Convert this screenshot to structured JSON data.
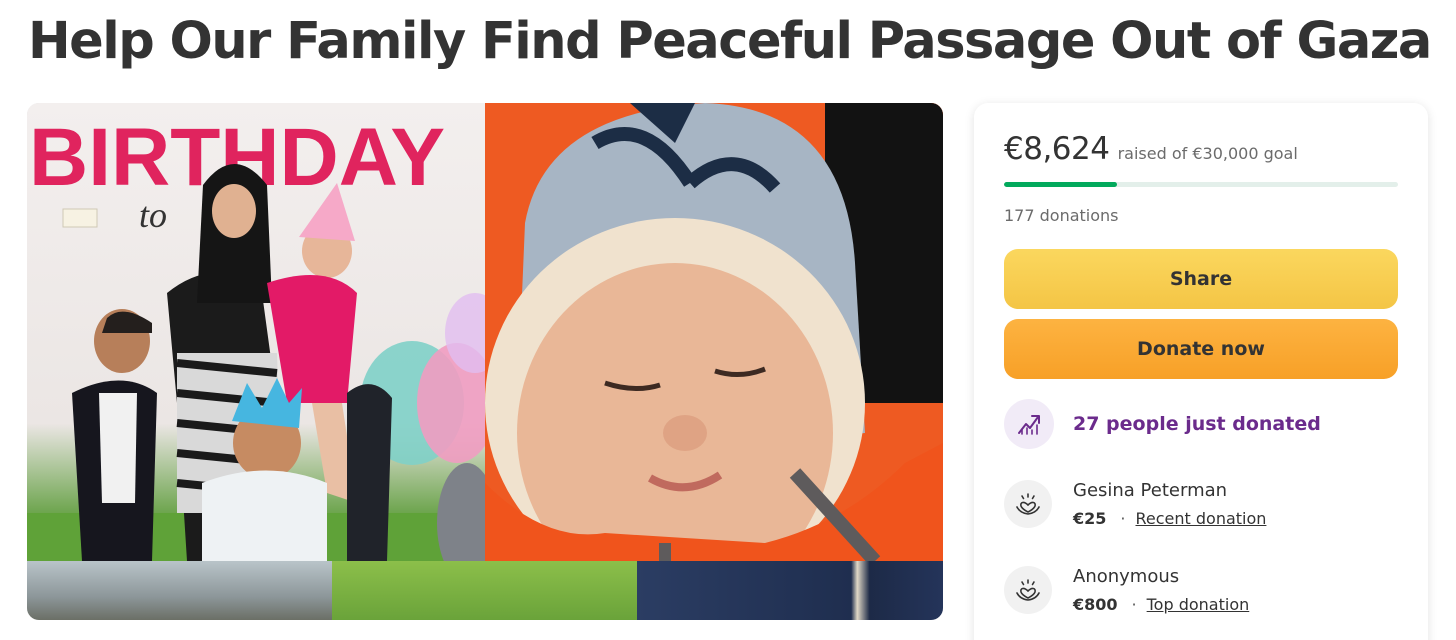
{
  "page": {
    "title": "Help Our Family Find Peaceful Passage Out of Gaza"
  },
  "photo": {
    "banner_text_1": "BIRTHDAY",
    "banner_text_2": "to"
  },
  "campaign": {
    "raised": "€8,624",
    "goal_text": "raised of €30,000 goal",
    "progress_fraction": 0.2875,
    "donations": "177 donations"
  },
  "actions": {
    "share_label": "Share",
    "donate_label": "Donate now"
  },
  "activity": {
    "recent_text": "27 people just donated",
    "icon": "trending-up-icon"
  },
  "donors": [
    {
      "name": "Gesina Peterman",
      "amount": "€25",
      "separator": "·",
      "tag": "Recent donation"
    },
    {
      "name": "Anonymous",
      "amount": "€800",
      "separator": "·",
      "tag": "Top donation"
    }
  ],
  "colors": {
    "progress": "#02a95c",
    "share_button": "#f6c94d",
    "donate_button": "#f9a931",
    "accent_purple": "#6b2b8c"
  }
}
